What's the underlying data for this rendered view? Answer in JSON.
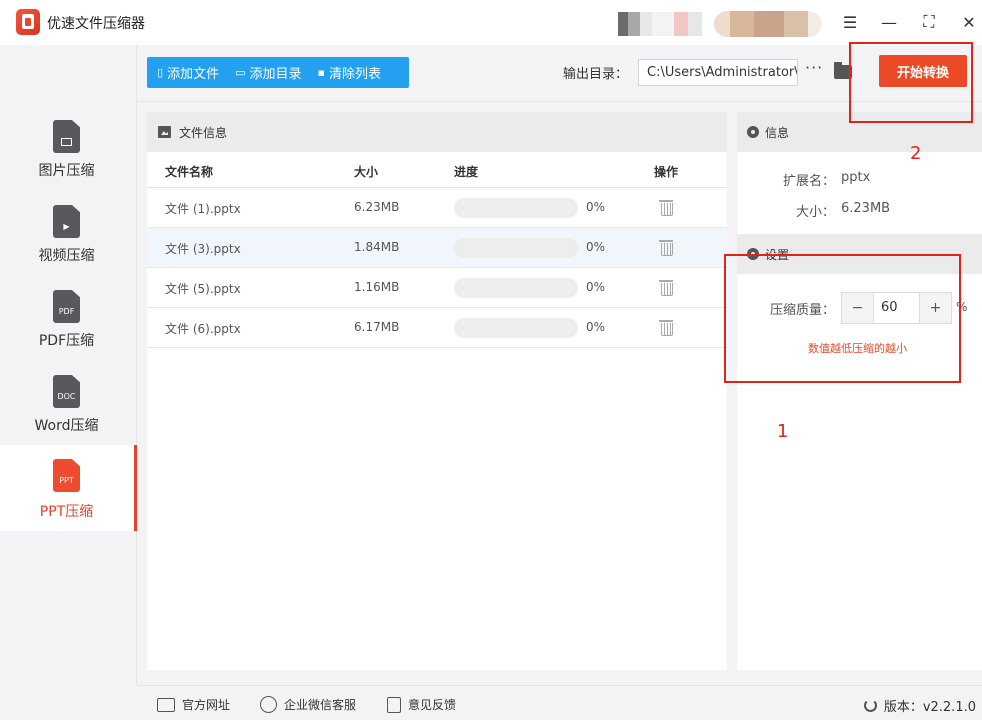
{
  "app": {
    "title": "优速文件压缩器"
  },
  "window": {
    "menu_glyph": "☰",
    "minimize_glyph": "—",
    "maximize_glyph": "⛶",
    "close_glyph": "✕"
  },
  "sidebar": {
    "items": [
      {
        "label": "图片压缩",
        "badge": "",
        "active": false
      },
      {
        "label": "视频压缩",
        "badge": "▶",
        "active": false
      },
      {
        "label": "PDF压缩",
        "badge": "PDF",
        "active": false
      },
      {
        "label": "Word压缩",
        "badge": "DOC",
        "active": false
      },
      {
        "label": "PPT压缩",
        "badge": "PPT",
        "active": true
      }
    ]
  },
  "toolbar": {
    "add_file": "添加文件",
    "add_dir": "添加目录",
    "clear_list": "清除列表",
    "output_label": "输出目录：",
    "output_path": "C:\\Users\\Administrator\\",
    "more": "···",
    "start": "开始转换"
  },
  "file_panel": {
    "title": "文件信息",
    "columns": {
      "name": "文件名称",
      "size": "大小",
      "progress": "进度",
      "action": "操作"
    },
    "rows": [
      {
        "name": "文件 (1).pptx",
        "size": "6.23MB",
        "progress": 0,
        "progress_text": "0%"
      },
      {
        "name": "文件 (3).pptx",
        "size": "1.84MB",
        "progress": 0,
        "progress_text": "0%"
      },
      {
        "name": "文件 (5).pptx",
        "size": "1.16MB",
        "progress": 0,
        "progress_text": "0%"
      },
      {
        "name": "文件 (6).pptx",
        "size": "6.17MB",
        "progress": 0,
        "progress_text": "0%"
      }
    ]
  },
  "info": {
    "title": "信息",
    "ext_label": "扩展名：",
    "ext_value": "pptx",
    "size_label": "大小：",
    "size_value": "6.23MB"
  },
  "settings": {
    "title": "设置",
    "quality_label": "压缩质量：",
    "quality_value": "60",
    "unit": "%",
    "minus": "−",
    "plus": "+",
    "hint": "数值越低压缩的越小"
  },
  "annotations": {
    "n1": "1",
    "n2": "2",
    "color": "#e2231a"
  },
  "footer": {
    "website": "官方网址",
    "wechat": "企业微信客服",
    "feedback": "意见反馈",
    "version": "版本：v2.2.1.0"
  }
}
